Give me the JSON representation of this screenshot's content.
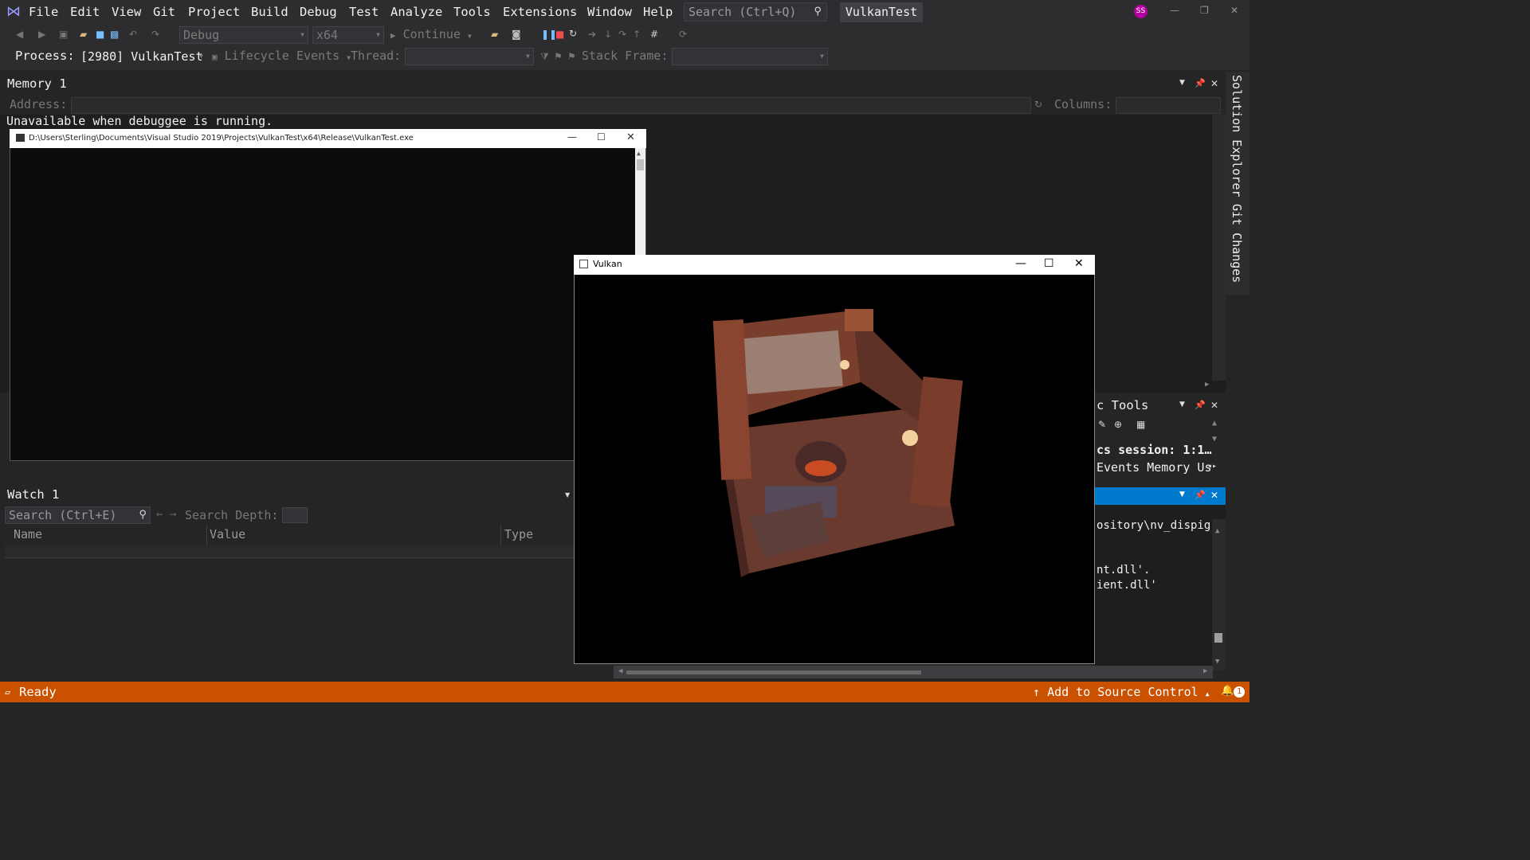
{
  "menu": {
    "items": [
      "File",
      "Edit",
      "View",
      "Git",
      "Project",
      "Build",
      "Debug",
      "Test",
      "Analyze",
      "Tools",
      "Extensions",
      "Window",
      "Help"
    ],
    "search_placeholder": "Search (Ctrl+Q)",
    "solution_name": "VulkanTest",
    "avatar_initials": "SS"
  },
  "toolbar": {
    "configuration": "Debug",
    "platform": "x64",
    "continue_label": "Continue",
    "process_label": "Process:",
    "process_value": "[2980] VulkanTest",
    "lifecycle_label": "Lifecycle Events",
    "thread_label": "Thread:",
    "stack_frame_label": "Stack Frame:"
  },
  "memory": {
    "title": "Memory 1",
    "address_label": "Address:",
    "columns_label": "Columns:",
    "message": "Unavailable when debuggee is running."
  },
  "right_tabs": [
    "Solution Explorer",
    "Git Changes"
  ],
  "console": {
    "title": "D:\\Users\\Sterling\\Documents\\Visual Studio 2019\\Projects\\VulkanTest\\x64\\Release\\VulkanTest.exe"
  },
  "watch": {
    "title": "Watch 1",
    "search_placeholder": "Search (Ctrl+E)",
    "search_depth_label": "Search Depth:",
    "columns": [
      "Name",
      "Value",
      "Type"
    ]
  },
  "vulkan": {
    "title": "Vulkan"
  },
  "diagnostics": {
    "title": "c Tools",
    "session": "cs session: 1:1…",
    "tabs": "Events Memory Us"
  },
  "output": {
    "lines": [
      "ository\\nv_dispig.",
      "nt.dll'.",
      "ient.dll'"
    ]
  },
  "status": {
    "ready": "Ready",
    "source_control": "Add to Source Control",
    "notifications": "1"
  },
  "colors": {
    "accent": "#007acc",
    "statusbar": "#ca5100",
    "background": "#252526"
  }
}
